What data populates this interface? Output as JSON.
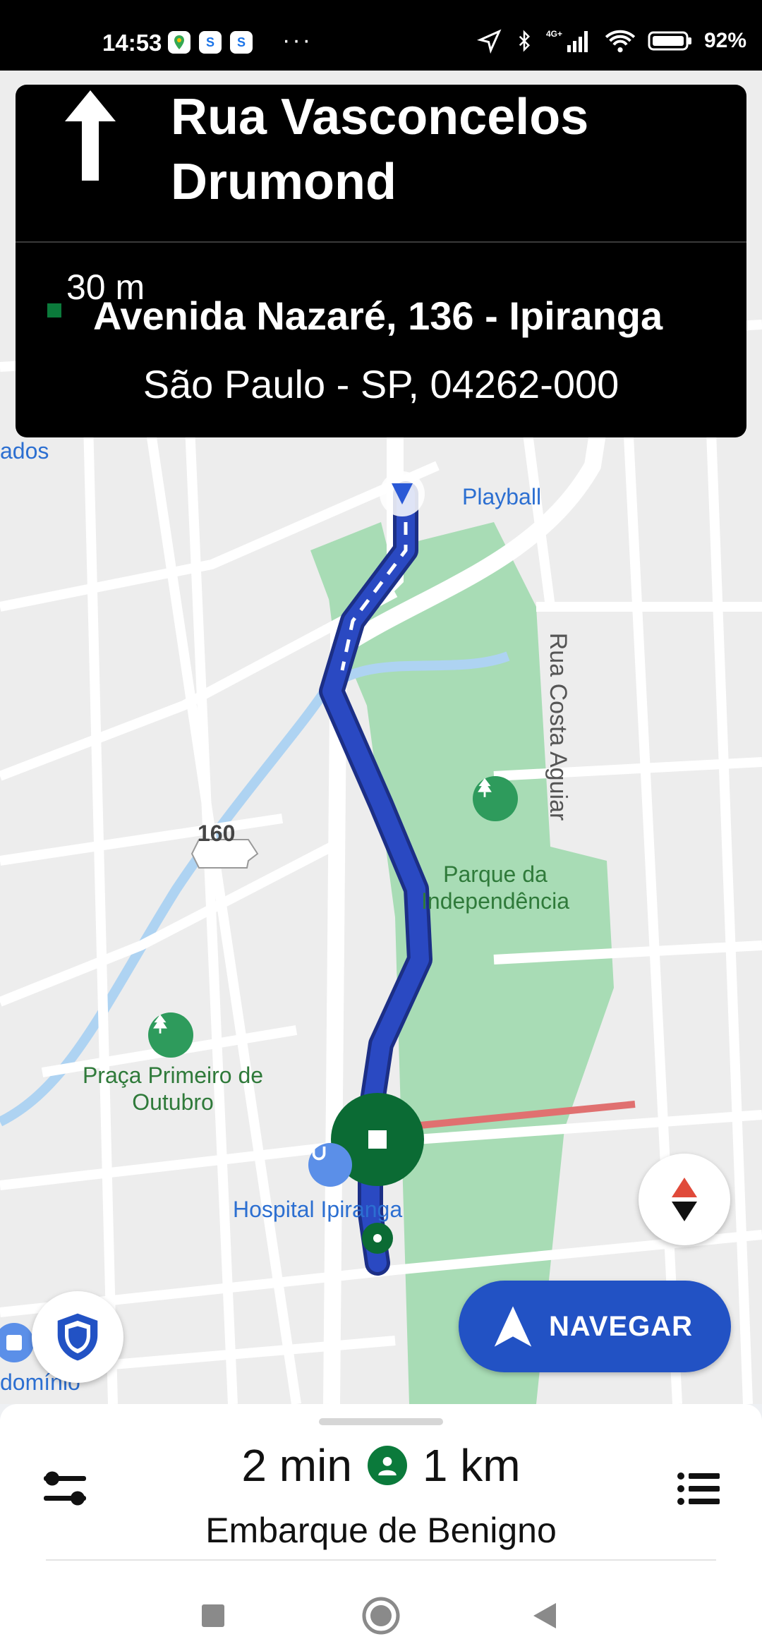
{
  "status_bar": {
    "time": "14:53",
    "battery": "92%",
    "more": "···"
  },
  "navigation": {
    "distance": "30 m",
    "street": "Rua Vasconcelos Drumond",
    "destination_line1": "Avenida Nazaré, 136 - Ipiranga",
    "destination_line2": "São Paulo - SP, 04262-000"
  },
  "map": {
    "labels": {
      "playball": "Playball",
      "rua_costa_aguiar": "Rua Costa Aguiar",
      "route_160": "160",
      "parque": "Parque da Independência",
      "praca": "Praça Primeiro de Outubro",
      "hospital": "Hospital Ipiranga",
      "partial_left_top": "ados",
      "partial_left_bottom": "domínio"
    }
  },
  "buttons": {
    "navegar": "NAVEGAR"
  },
  "trip": {
    "time": "2 min",
    "distance": "1 km",
    "pickup": "Embarque de Benigno"
  },
  "colors": {
    "route": "#2a49c2",
    "park": "#a8dcb5",
    "water": "#aed3f2",
    "destination": "#0b7a3b",
    "navegar_button": "#2252c4"
  }
}
